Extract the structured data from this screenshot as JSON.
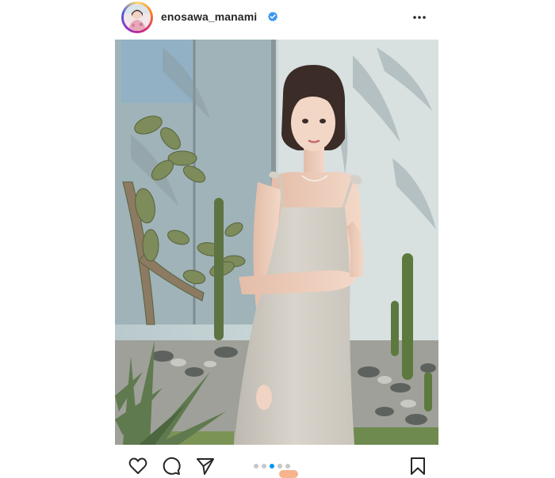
{
  "post": {
    "username": "enosawa_manami",
    "verified": true,
    "media": {
      "type": "photo",
      "carousel_count": 5,
      "active_index": 3
    }
  },
  "icons": {
    "more": "more-horizontal-icon",
    "like": "heart-icon",
    "comment": "comment-icon",
    "share": "send-icon",
    "save": "bookmark-icon",
    "verified": "verified-badge-icon"
  },
  "colors": {
    "verified": "#3897f0",
    "active_dot": "#0095f6",
    "inactive_dot": "#c7c7c7",
    "text": "#262626"
  }
}
